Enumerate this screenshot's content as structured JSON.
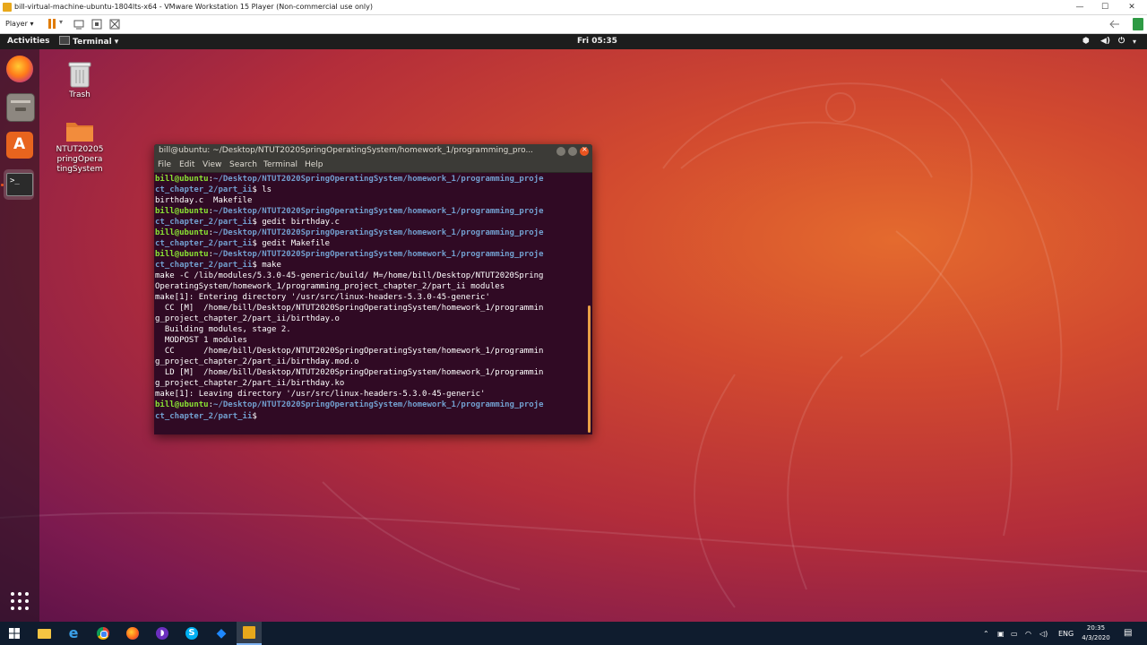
{
  "vmware": {
    "title": "bill-virtual-machine-ubuntu-1804lts-x64 - VMware Workstation 15 Player (Non-commercial use only)",
    "player_label": "Player",
    "player_caret": "▾",
    "minimize": "—",
    "maximize": "☐",
    "close": "✕"
  },
  "ubuntu": {
    "activities": "Activities",
    "app_menu": "Terminal",
    "app_menu_caret": "▾",
    "clock": "Fri 05:35",
    "tray_icons": [
      "network-icon",
      "volume-icon",
      "power-icon"
    ]
  },
  "desktop_icons": [
    {
      "label": "Trash"
    },
    {
      "label": "NTUT2020SpringOperatingSystem"
    }
  ],
  "desktop_label_lines": [
    "NTUT20205",
    "pringOpera",
    "tingSystem"
  ],
  "terminal": {
    "title": "bill@ubuntu: ~/Desktop/NTUT2020SpringOperatingSystem/homework_1/programming_pro...",
    "menu": [
      "File",
      "Edit",
      "View",
      "Search",
      "Terminal",
      "Help"
    ],
    "prompt_user": "bill@ubuntu",
    "prompt_path_a": "~/Desktop/NTUT2020SpringOperatingSystem/homework_1/programming_proje",
    "prompt_path_b": "ct_chapter_2/part_ii",
    "commands": [
      "ls",
      "gedit birthday.c",
      "gedit Makefile",
      "make"
    ],
    "ls_output": "birthday.c  Makefile",
    "make_output": [
      "make -C /lib/modules/5.3.0-45-generic/build/ M=/home/bill/Desktop/NTUT2020Spring",
      "OperatingSystem/homework_1/programming_project_chapter_2/part_ii modules",
      "make[1]: Entering directory '/usr/src/linux-headers-5.3.0-45-generic'",
      "  CC [M]  /home/bill/Desktop/NTUT2020SpringOperatingSystem/homework_1/programmin",
      "g_project_chapter_2/part_ii/birthday.o",
      "  Building modules, stage 2.",
      "  MODPOST 1 modules",
      "  CC      /home/bill/Desktop/NTUT2020SpringOperatingSystem/homework_1/programmin",
      "g_project_chapter_2/part_ii/birthday.mod.o",
      "  LD [M]  /home/bill/Desktop/NTUT2020SpringOperatingSystem/homework_1/programmin",
      "g_project_chapter_2/part_ii/birthday.ko",
      "make[1]: Leaving directory '/usr/src/linux-headers-5.3.0-45-generic'"
    ]
  },
  "windows_taskbar": {
    "lang": "ENG",
    "time": "20:35",
    "date": "4/3/2020"
  },
  "colors": {
    "ubuntu_orange": "#e95420",
    "terminal_bg": "#300a24",
    "prompt_green": "#8ae234",
    "prompt_blue": "#729fcf"
  }
}
